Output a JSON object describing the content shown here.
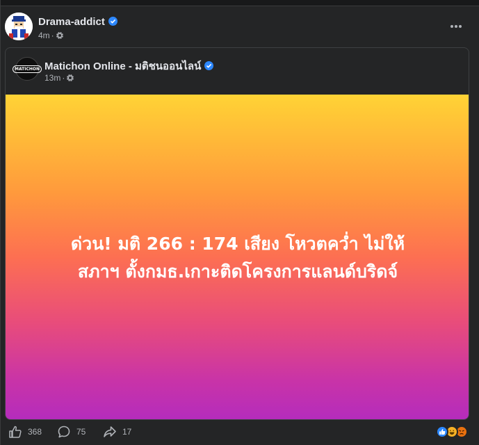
{
  "post": {
    "author": "Drama-addict",
    "time": "4m",
    "meta_separator": "·"
  },
  "shared": {
    "page_name": "Matichon Online - มติชนออนไลน์",
    "time": "13m",
    "meta_separator": "·",
    "avatar_text": "MATICHON",
    "banner_lines": [
      "ด่วน! มติ 266 : 174 เสียง โหวตคว่ำ ไม่ให้",
      "สภาฯ ตั้งกมธ.เกาะติดโครงการแลนด์บริดจ์"
    ]
  },
  "footer": {
    "likes": "368",
    "comments": "75",
    "shares": "17"
  },
  "colors": {
    "background": "#242526",
    "verified": "#2d88ff",
    "like": "#2d88ff",
    "haha": "#f7b125",
    "angry": "#e9710f"
  },
  "icons": [
    "verified-badge-icon",
    "globe-icon",
    "more-options-icon",
    "like-icon",
    "comment-icon",
    "share-icon",
    "like-reaction-icon",
    "haha-reaction-icon",
    "angry-reaction-icon"
  ]
}
